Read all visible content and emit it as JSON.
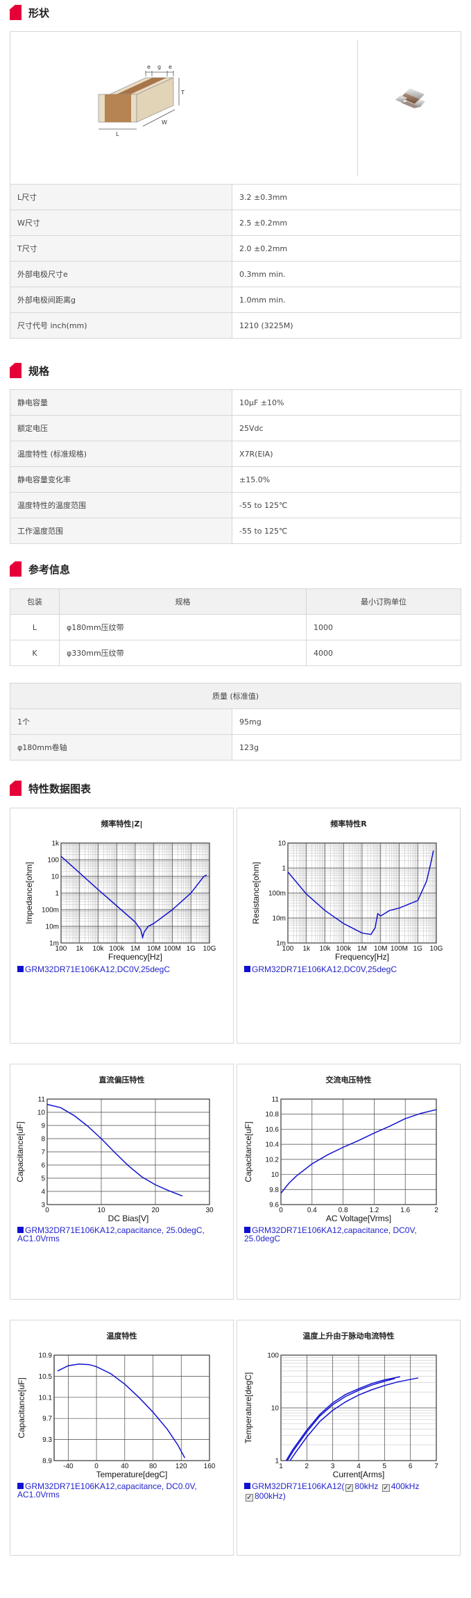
{
  "sections": {
    "shape": {
      "title": "形状"
    },
    "spec": {
      "title": "规格"
    },
    "ref": {
      "title": "参考信息"
    },
    "charts": {
      "title": "特性数据图表"
    }
  },
  "shape_diagram": {
    "label_e1": "e",
    "label_g": "g",
    "label_e2": "e",
    "label_T": "T",
    "label_W": "W",
    "label_L": "L"
  },
  "shape_rows": [
    {
      "k": "L尺寸",
      "v": "3.2 ±0.3mm"
    },
    {
      "k": "W尺寸",
      "v": "2.5 ±0.2mm"
    },
    {
      "k": "T尺寸",
      "v": "2.0 ±0.2mm"
    },
    {
      "k": "外部电极尺寸e",
      "v": "0.3mm min."
    },
    {
      "k": "外部电极间距离g",
      "v": "1.0mm min."
    },
    {
      "k": "尺寸代号 inch(mm)",
      "v": "1210 (3225M)"
    }
  ],
  "spec_rows": [
    {
      "k": "静电容量",
      "v": "10μF ±10%"
    },
    {
      "k": "额定电压",
      "v": "25Vdc"
    },
    {
      "k": "温度特性 (标准规格)",
      "v": "X7R(EIA)"
    },
    {
      "k": "静电容量变化率",
      "v": "±15.0%"
    },
    {
      "k": "温度特性的温度范围",
      "v": "-55 to 125℃"
    },
    {
      "k": "工作温度范围",
      "v": "-55 to 125℃"
    }
  ],
  "packaging": {
    "headers": [
      "包装",
      "规格",
      "最小订购单位"
    ],
    "rows": [
      {
        "code": "L",
        "spec": "φ180mm压纹带",
        "min": "1000"
      },
      {
        "code": "K",
        "spec": "φ330mm压纹带",
        "min": "4000"
      }
    ]
  },
  "mass": {
    "header": "质量 (标准值)",
    "rows": [
      {
        "k": "1个",
        "v": "95mg"
      },
      {
        "k": "φ180mm卷轴",
        "v": "123g"
      }
    ]
  },
  "charts_info": [
    {
      "title": "频率特性|Z|",
      "legend": "GRM32DR71E106KA12,DC0V,25degC"
    },
    {
      "title": "频率特性R",
      "legend": "GRM32DR71E106KA12,DC0V,25degC"
    },
    {
      "title": "直流偏压特性",
      "legend": "GRM32DR71E106KA12,capacitance, 25.0degC, AC1.0Vrms"
    },
    {
      "title": "交流电压特性",
      "legend": "GRM32DR71E106KA12,capacitance, DC0V, 25.0degC"
    },
    {
      "title": "温度特性",
      "legend": "GRM32DR71E106KA12,capacitance, DC0.0V, AC1.0Vrms"
    },
    {
      "title": "温度上升由于脉动电流特性",
      "legend_part": "GRM32DR71E106KA12(",
      "opt1": "80kHz",
      "opt2": "400kHz",
      "opt3": "800kHz)"
    }
  ],
  "chart_data": [
    {
      "type": "line",
      "title": "频率特性|Z|",
      "xlabel": "Frequency[Hz]",
      "ylabel": "Impedance[ohm]",
      "xscale": "log",
      "yscale": "log",
      "xlim": [
        100,
        10000000000
      ],
      "ylim": [
        0.001,
        1000
      ],
      "xticks": [
        "100",
        "1k",
        "10k",
        "100k",
        "1M",
        "10M",
        "100M",
        "1G",
        "10G"
      ],
      "yticks": [
        "1m",
        "10m",
        "100m",
        "1",
        "10",
        "100",
        "1k"
      ],
      "grid": true,
      "color": "#1010d0",
      "series": [
        {
          "x": [
            100,
            1000,
            10000,
            100000,
            1000000,
            2000000,
            2500000,
            3000000,
            5000000,
            10000000,
            100000000,
            1000000000,
            5000000000,
            7000000000
          ],
          "y": [
            160,
            16,
            1.6,
            0.17,
            0.018,
            0.006,
            0.0022,
            0.0045,
            0.01,
            0.015,
            0.1,
            1.0,
            10,
            12
          ]
        }
      ]
    },
    {
      "type": "line",
      "title": "频率特性R",
      "xlabel": "Frequency[Hz]",
      "ylabel": "Resistance[ohm]",
      "xscale": "log",
      "yscale": "log",
      "xlim": [
        100,
        10000000000
      ],
      "ylim": [
        0.001,
        10
      ],
      "xticks": [
        "100",
        "1k",
        "10k",
        "100k",
        "1M",
        "10M",
        "100M",
        "1G",
        "10G"
      ],
      "yticks": [
        "1m",
        "10m",
        "100m",
        "1",
        "10"
      ],
      "grid": true,
      "color": "#1010d0",
      "series": [
        {
          "x": [
            100,
            1000,
            10000,
            100000,
            1000000,
            3000000,
            5000000,
            7000000,
            10000000,
            30000000,
            100000000,
            1000000000,
            3000000000,
            5000000000,
            7000000000
          ],
          "y": [
            0.7,
            0.09,
            0.02,
            0.006,
            0.0025,
            0.0022,
            0.004,
            0.015,
            0.012,
            0.02,
            0.025,
            0.05,
            0.3,
            1.5,
            5.0
          ]
        }
      ]
    },
    {
      "type": "line",
      "title": "直流偏压特性",
      "xlabel": "DC Bias[V]",
      "ylabel": "Capacitance[uF]",
      "xlim": [
        0,
        30
      ],
      "ylim": [
        3,
        11
      ],
      "xticks": [
        0,
        10,
        20,
        30
      ],
      "yticks": [
        3,
        4,
        5,
        6,
        7,
        8,
        9,
        10,
        11
      ],
      "grid": true,
      "color": "#1010d0",
      "series": [
        {
          "x": [
            0,
            2.5,
            5,
            7.5,
            10,
            12.5,
            15,
            17.5,
            20,
            22.5,
            25
          ],
          "y": [
            10.6,
            10.35,
            9.75,
            8.95,
            8.0,
            6.95,
            5.95,
            5.1,
            4.5,
            4.05,
            3.65
          ]
        }
      ]
    },
    {
      "type": "line",
      "title": "交流电压特性",
      "xlabel": "AC Voltage[Vrms]",
      "ylabel": "Capacitance[uF]",
      "xlim": [
        0,
        2
      ],
      "ylim": [
        9.6,
        11
      ],
      "xticks": [
        "0",
        "0.4",
        "0.8",
        "1.2",
        "1.6",
        "2"
      ],
      "yticks": [
        "9.6",
        "9.8",
        "10",
        "10.2",
        "10.4",
        "10.6",
        "10.8",
        "11"
      ],
      "grid": true,
      "color": "#1010d0",
      "series": [
        {
          "x": [
            0,
            0.1,
            0.2,
            0.4,
            0.6,
            0.8,
            1.0,
            1.2,
            1.4,
            1.6,
            1.8,
            2.0
          ],
          "y": [
            9.75,
            9.88,
            9.98,
            10.14,
            10.26,
            10.36,
            10.45,
            10.55,
            10.64,
            10.74,
            10.81,
            10.86
          ]
        }
      ]
    },
    {
      "type": "line",
      "title": "温度特性",
      "xlabel": "Temperature[degC]",
      "ylabel": "Capacitance[uF]",
      "xlim": [
        -60,
        160
      ],
      "ylim": [
        8.9,
        10.9
      ],
      "xticks": [
        -40,
        0,
        40,
        80,
        120,
        160
      ],
      "yticks": [
        "8.9",
        "9.3",
        "9.7",
        "10.1",
        "10.5",
        "10.9"
      ],
      "grid": true,
      "color": "#1010d0",
      "series": [
        {
          "x": [
            -55,
            -40,
            -25,
            -10,
            0,
            20,
            40,
            60,
            80,
            100,
            115,
            125
          ],
          "y": [
            10.6,
            10.7,
            10.73,
            10.72,
            10.68,
            10.55,
            10.35,
            10.1,
            9.82,
            9.5,
            9.2,
            8.95
          ]
        }
      ]
    },
    {
      "type": "line",
      "title": "温度上升由于脉动电流特性",
      "xlabel": "Current[Arms]",
      "ylabel": "Temperature[degC]",
      "xlim": [
        1,
        7
      ],
      "ylim": [
        1,
        100
      ],
      "yscale": "log",
      "xticks": [
        1,
        2,
        3,
        4,
        5,
        6,
        7
      ],
      "yticks": [
        "1",
        "10",
        "100"
      ],
      "grid": true,
      "color": "#1010d0",
      "series": [
        {
          "name": "80kHz",
          "x": [
            1.35,
            1.6,
            2,
            2.5,
            3,
            3.5,
            4,
            4.5,
            5,
            5.5,
            6.3
          ],
          "y": [
            1.0,
            1.5,
            2.8,
            5.5,
            9,
            13,
            17.5,
            22,
            26.5,
            31,
            37
          ]
        },
        {
          "name": "400kHz",
          "x": [
            1.25,
            1.5,
            2,
            2.5,
            3,
            3.5,
            4,
            4.5,
            5,
            5.4
          ],
          "y": [
            1.0,
            1.6,
            3.5,
            7,
            11.5,
            16.5,
            21.5,
            27,
            32,
            36
          ]
        },
        {
          "name": "800kHz",
          "x": [
            1.2,
            1.45,
            2,
            2.5,
            3,
            3.5,
            4,
            4.5,
            5,
            5.6
          ],
          "y": [
            1.0,
            1.6,
            3.8,
            7.5,
            12.5,
            18,
            23,
            29,
            34,
            39
          ]
        }
      ]
    }
  ]
}
